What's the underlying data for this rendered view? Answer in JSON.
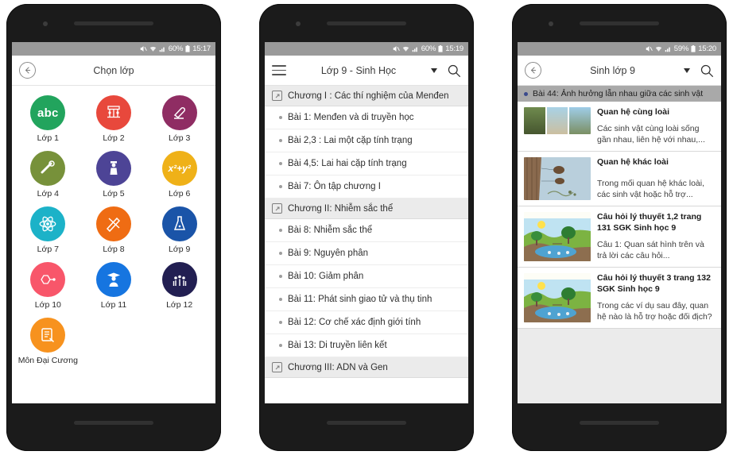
{
  "phone1": {
    "statusbar": {
      "mute_icon": "mute-icon",
      "wifi_icon": "wifi-icon",
      "signal_icon": "signal-icon",
      "battery": "60%",
      "battery_icon": "battery-icon",
      "time": "15:17"
    },
    "appbar": {
      "back_icon": "back-arrow-icon",
      "title": "Chọn lớp"
    },
    "tiles": [
      {
        "label": "Lớp 1",
        "color": "#22a45d",
        "glyph": "abc",
        "icon": "abc-icon"
      },
      {
        "label": "Lớp 2",
        "color": "#e8483c",
        "glyph": "",
        "icon": "abacus-icon"
      },
      {
        "label": "Lớp 3",
        "color": "#8f2d63",
        "glyph": "",
        "icon": "eraser-icon"
      },
      {
        "label": "Lớp 4",
        "color": "#77913a",
        "glyph": "",
        "icon": "diploma-icon"
      },
      {
        "label": "Lớp 5",
        "color": "#4d4496",
        "glyph": "",
        "icon": "student-icon"
      },
      {
        "label": "Lớp 6",
        "color": "#efb118",
        "glyph": "x²+y²",
        "icon": "algebra-icon"
      },
      {
        "label": "Lớp 7",
        "color": "#1cb2c8",
        "glyph": "",
        "icon": "atom-icon"
      },
      {
        "label": "Lớp 8",
        "color": "#ef6c13",
        "glyph": "",
        "icon": "pencil-ruler-icon"
      },
      {
        "label": "Lớp 9",
        "color": "#1a54a8",
        "glyph": "",
        "icon": "flask-icon"
      },
      {
        "label": "Lớp 10",
        "color": "#f8566a",
        "glyph": "",
        "icon": "molecule-icon"
      },
      {
        "label": "Lớp 11",
        "color": "#1675e0",
        "glyph": "",
        "icon": "graduate-icon"
      },
      {
        "label": "Lớp 12",
        "color": "#221f52",
        "glyph": "",
        "icon": "celebration-icon"
      },
      {
        "label": "Môn Đại Cương",
        "color": "#f7921e",
        "glyph": "",
        "icon": "notepad-icon"
      }
    ]
  },
  "phone2": {
    "statusbar": {
      "battery": "60%",
      "time": "15:19"
    },
    "appbar": {
      "menu_icon": "hamburger-menu-icon",
      "title": "Lớp 9 - Sinh Học",
      "dropdown_icon": "caret-down-icon",
      "search_icon": "search-icon"
    },
    "items": [
      {
        "type": "chapter",
        "text": "Chương I : Các thí nghiệm của Menđen"
      },
      {
        "type": "lesson",
        "text": "Bài 1: Menđen và di truyền học"
      },
      {
        "type": "lesson",
        "text": "Bài 2,3 : Lai một cặp tính trạng"
      },
      {
        "type": "lesson",
        "text": "Bài 4,5: Lai hai cặp tính trạng"
      },
      {
        "type": "lesson",
        "text": "Bài 7: Ôn tập chương I"
      },
      {
        "type": "chapter",
        "text": "Chương II:  Nhiễm sắc thể"
      },
      {
        "type": "lesson",
        "text": "Bài 8: Nhiễm sắc thể"
      },
      {
        "type": "lesson",
        "text": "Bài 9: Nguyên phân"
      },
      {
        "type": "lesson",
        "text": "Bài 10: Giảm phân"
      },
      {
        "type": "lesson",
        "text": "Bài 11: Phát sinh giao tử và thụ tinh"
      },
      {
        "type": "lesson",
        "text": "Bài 12: Cơ chế xác định giới tính"
      },
      {
        "type": "lesson",
        "text": "Bài 13: Di truyền liên kết"
      },
      {
        "type": "chapter",
        "text": "Chương III: ADN và Gen"
      }
    ]
  },
  "phone3": {
    "statusbar": {
      "battery": "59%",
      "time": "15:20"
    },
    "appbar": {
      "back_icon": "back-arrow-icon",
      "title": "Sinh lớp 9",
      "dropdown_icon": "caret-down-icon",
      "search_icon": "search-icon"
    },
    "topic": "Bài 44: Ảnh hưởng lẫn nhau giữa các sinh vật",
    "cards": [
      {
        "title": "Quan hệ cùng loài",
        "desc": "Các sinh vật cùng loài sống gần nhau, liên hệ với nhau,...",
        "thumb": "photo-strip-thumbnail"
      },
      {
        "title": "Quan hệ khác loài",
        "desc": "Trong mối quan hệ khác loài, các sinh vật hoặc hỗ trợ...",
        "thumb": "cliff-diagram-thumbnail"
      },
      {
        "title": "Câu hỏi lý thuyết 1,2 trang 131 SGK Sinh học 9",
        "desc": "Câu 1: Quan sát hình trên và trả lời các câu hỏi...",
        "thumb": "ecosystem-diagram-thumbnail"
      },
      {
        "title": "Câu hỏi lý thuyết 3 trang 132 SGK Sinh học 9",
        "desc": "Trong các ví dụ sau đây, quan hệ nào là hỗ trợ hoặc đối địch?",
        "thumb": "ecosystem-diagram-thumbnail"
      }
    ]
  }
}
